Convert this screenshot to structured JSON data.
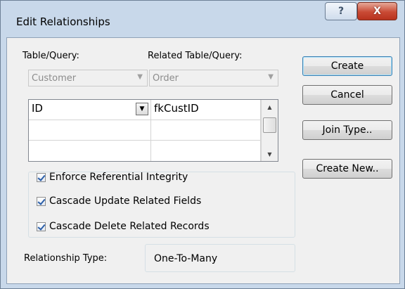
{
  "window": {
    "title": "Edit Relationships",
    "help_glyph": "?",
    "close_glyph": "X"
  },
  "table_query": {
    "label": "Table/Query:",
    "value": "Customer"
  },
  "related_table_query": {
    "label": "Related Table/Query:",
    "value": "Order"
  },
  "fields_grid": {
    "rows": [
      {
        "left": "ID",
        "right": "fkCustID"
      },
      {
        "left": "",
        "right": ""
      },
      {
        "left": "",
        "right": ""
      }
    ]
  },
  "options": {
    "enforce_integrity": {
      "label": "Enforce Referential Integrity",
      "checked": true
    },
    "cascade_update": {
      "label": "Cascade Update Related Fields",
      "checked": true
    },
    "cascade_delete": {
      "label": "Cascade Delete Related Records",
      "checked": true
    }
  },
  "relationship_type": {
    "label": "Relationship Type:",
    "value": "One-To-Many"
  },
  "buttons": {
    "create": "Create",
    "cancel": "Cancel",
    "join_type": "Join Type..",
    "create_new": "Create New.."
  },
  "icons": {
    "dropdown": "chevron-down-icon",
    "scroll_up": "arrow-up-icon",
    "scroll_down": "arrow-down-icon",
    "checkmark": "checkmark-icon"
  }
}
